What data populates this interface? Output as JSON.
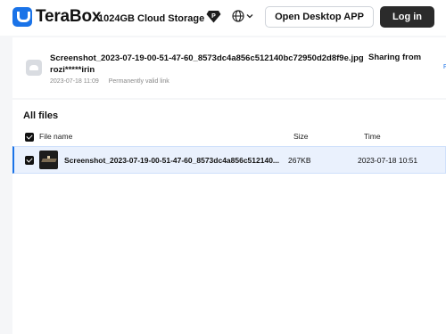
{
  "header": {
    "brand": "TeraBox",
    "storage": "1024GB Cloud Storage",
    "premium_icon": "p-diamond-icon",
    "language_icon": "globe-icon",
    "open_desktop_label": "Open Desktop APP",
    "login_label": "Log in"
  },
  "share": {
    "file_name": "Screenshot_2023-07-19-00-51-47-60_8573dc4a856c512140bc72950d2d8f9e.jpg",
    "sharing_from": "Sharing from",
    "owner": "rozi*****irin",
    "date": "2023-07-18 11:09",
    "validity": "Permanently valid link",
    "edge_text": "F"
  },
  "files": {
    "title": "All files",
    "columns": {
      "name": "File name",
      "size": "Size",
      "time": "Time"
    },
    "rows": [
      {
        "name": "Screenshot_2023-07-19-00-51-47-60_8573dc4a856c512140...",
        "size": "267KB",
        "time": "2023-07-18 10:51",
        "checked": true
      }
    ]
  },
  "colors": {
    "accent": "#1a73e8",
    "login_bg": "#2b2b2b",
    "selected_row": "#eaf1fd"
  }
}
